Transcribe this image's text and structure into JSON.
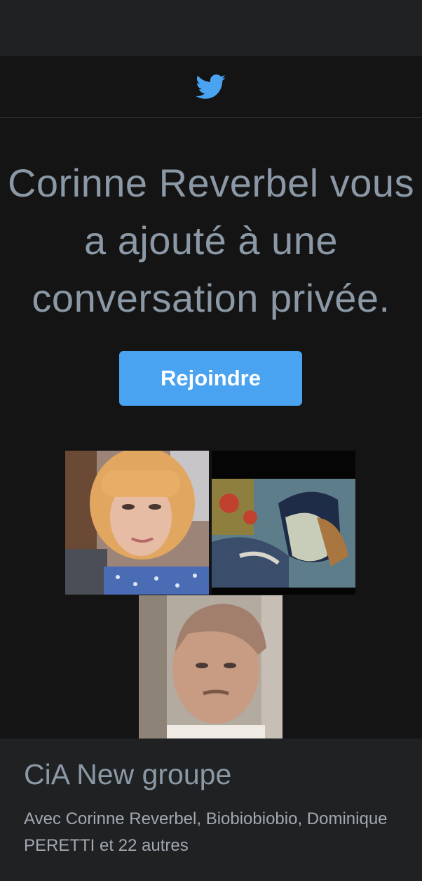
{
  "header": {
    "logo_icon": "twitter-bird-icon",
    "logo_color": "#4aa3f0"
  },
  "invite": {
    "headline": "Corinne Reverbel vous a ajouté à une conversation privée.",
    "join_label": "Rejoindre"
  },
  "participants": {
    "avatars": [
      {
        "name": "avatar-corinne-reverbel"
      },
      {
        "name": "avatar-biobiobiobio"
      },
      {
        "name": "avatar-dominique-peretti"
      }
    ]
  },
  "group": {
    "name": "CiA New groupe",
    "members": "Avec Corinne Reverbel, Biobiobiobio, Dominique PERETTI et 22 autres"
  },
  "colors": {
    "background": "#141414",
    "panel": "#202123",
    "accent": "#4aa3f0",
    "text_muted": "#8b98a5"
  }
}
